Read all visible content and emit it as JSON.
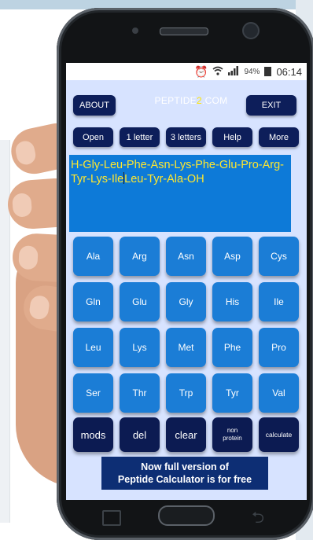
{
  "app": {
    "logo_part1": "PEPTIDE",
    "logo_part2": "2",
    "logo_part3": ".COM"
  },
  "status_bar": {
    "alarm_icon": "alarm-icon",
    "wifi_icon": "wifi-icon",
    "signal_icon": "signal-icon",
    "battery_percent": "94%",
    "time": "06:14"
  },
  "top_buttons": {
    "about": "ABOUT",
    "exit": "EXIT"
  },
  "toolbar": {
    "open": "Open",
    "one_letter": "1 letter",
    "three_letters": "3 letters",
    "help": "Help",
    "more": "More"
  },
  "sequence": {
    "before_cursor": "H-Gly-Leu-Phe-Asn-Lys-Phe-Glu-Pro-Arg-Tyr-Lys-Ile",
    "after_cursor": "Leu-Tyr-Ala-OH"
  },
  "amino_acids": [
    "Ala",
    "Arg",
    "Asn",
    "Asp",
    "Cys",
    "Gln",
    "Glu",
    "Gly",
    "His",
    "Ile",
    "Leu",
    "Lys",
    "Met",
    "Phe",
    "Pro",
    "Ser",
    "Thr",
    "Trp",
    "Tyr",
    "Val"
  ],
  "functions": {
    "mods": "mods",
    "del": "del",
    "clear": "clear",
    "non_protein_1": "non",
    "non_protein_2": "protein",
    "calculate": "calculate"
  },
  "banner": {
    "line1": "Now full version of",
    "line2": "Peptide Calculator is for free"
  },
  "colors": {
    "screen_bg": "#d7e3ff",
    "amino_button": "#1b7dd6",
    "dark_button": "#0c1b52",
    "sequence_bg": "#0d7ad8",
    "sequence_text": "#ffe72e",
    "logo_accent": "#ffe600"
  }
}
